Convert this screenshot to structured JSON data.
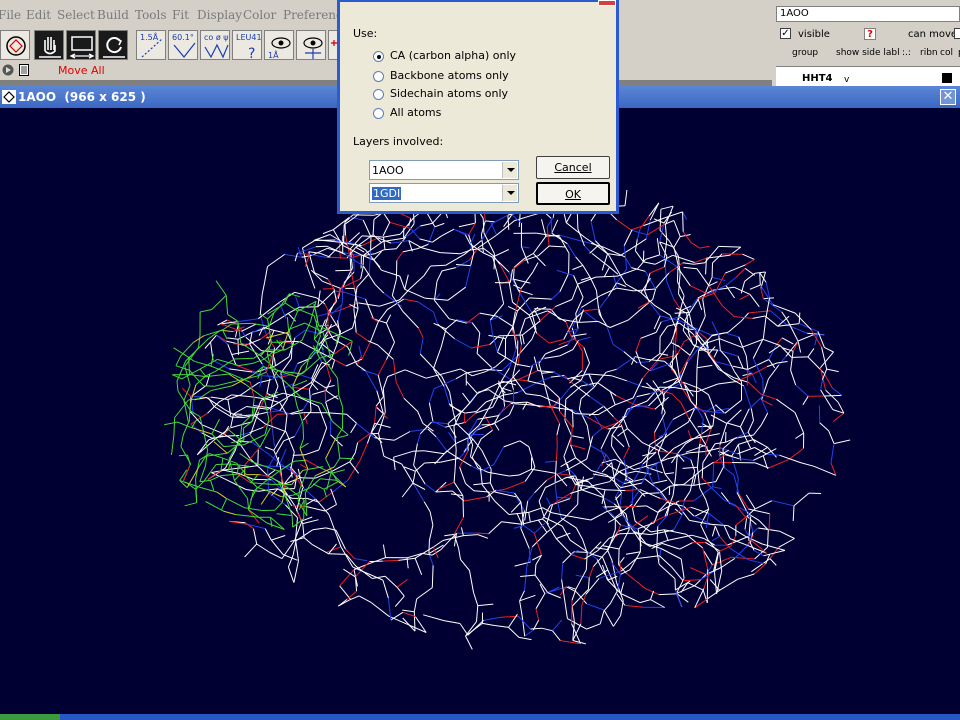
{
  "menubar": {
    "items": [
      "File",
      "Edit",
      "Select",
      "Build",
      "Tools",
      "Fit",
      "Display",
      "Color",
      "Preferences"
    ]
  },
  "toolbar": {
    "buttons": [
      {
        "icon": "molecule-icon"
      },
      {
        "icon": "hand-move-icon"
      },
      {
        "icon": "monitor-icon"
      },
      {
        "icon": "rotate-icon"
      },
      {
        "icon": "distance-measure-icon",
        "label": "1.5Å"
      },
      {
        "icon": "angle-measure-icon",
        "label": "60.1°"
      },
      {
        "icon": "dihedral-icon",
        "label": "co ø ψ"
      },
      {
        "icon": "residue-label-icon",
        "label": "LEU41"
      },
      {
        "icon": "eye-center-icon"
      },
      {
        "icon": "eye-zoom-icon"
      },
      {
        "icon": "crosshair-icon"
      }
    ]
  },
  "status": {
    "move_label": "Move All"
  },
  "layer_panel": {
    "title": "1AOO",
    "visible_label": "visible",
    "visible_checked": "✓",
    "help_label": "?",
    "can_move_label": "can move",
    "columns": [
      "group",
      "show side labl",
      ":.:",
      "ribn",
      "col",
      "p"
    ],
    "row_name": "HHT4",
    "row_flag": "v"
  },
  "graphics_window": {
    "title": "1AOO  (966 x 625 )",
    "close_label": "✕"
  },
  "dialog": {
    "use_label": "Use:",
    "options": [
      {
        "label": "CA (carbon alpha) only",
        "selected": true
      },
      {
        "label": "Backbone atoms only",
        "selected": false
      },
      {
        "label": "Sidechain atoms only",
        "selected": false
      },
      {
        "label": "All atoms",
        "selected": false
      }
    ],
    "layers_label": "Layers involved:",
    "layer1": "1AOO",
    "layer2": "1GDI",
    "cancel_label": "Cancel",
    "ok_label": "OK"
  },
  "colors": {
    "viewer_background": "#000033",
    "bond_white": "#ffffff",
    "bond_blue": "#2244ee",
    "bond_red": "#ee2222",
    "bond_green": "#44dd33",
    "bond_yellow": "#ddcc22",
    "window_title": "#3a67c2",
    "dialog_face": "#ece9d8"
  }
}
